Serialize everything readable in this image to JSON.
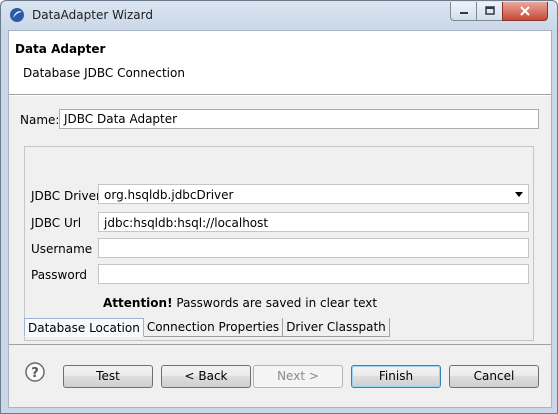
{
  "window": {
    "title": "DataAdapter Wizard",
    "icon": "eclipse-icon"
  },
  "header": {
    "title": "Data Adapter",
    "subtitle": "Database JDBC Connection"
  },
  "name_field": {
    "label": "Name:",
    "value": "JDBC Data Adapter"
  },
  "connection": {
    "driver_label": "JDBC Driver",
    "driver_value": "org.hsqldb.jdbcDriver",
    "url_label": "JDBC Url",
    "url_value": "jdbc:hsqldb:hsql://localhost",
    "username_label": "Username",
    "username_value": "",
    "password_label": "Password",
    "password_value": "",
    "attention_bold": "Attention!",
    "attention_text": " Passwords are saved in clear text"
  },
  "tabs": [
    {
      "label": "Database Location",
      "active": true
    },
    {
      "label": "Connection Properties",
      "active": false
    },
    {
      "label": "Driver Classpath",
      "active": false
    }
  ],
  "buttons": {
    "test": "Test",
    "back": "< Back",
    "next": "Next >",
    "finish": "Finish",
    "cancel": "Cancel"
  },
  "colors": {
    "titlebar": "#c9d7e8",
    "close_button": "#c7493a",
    "default_button_border": "#3c7fb1"
  }
}
